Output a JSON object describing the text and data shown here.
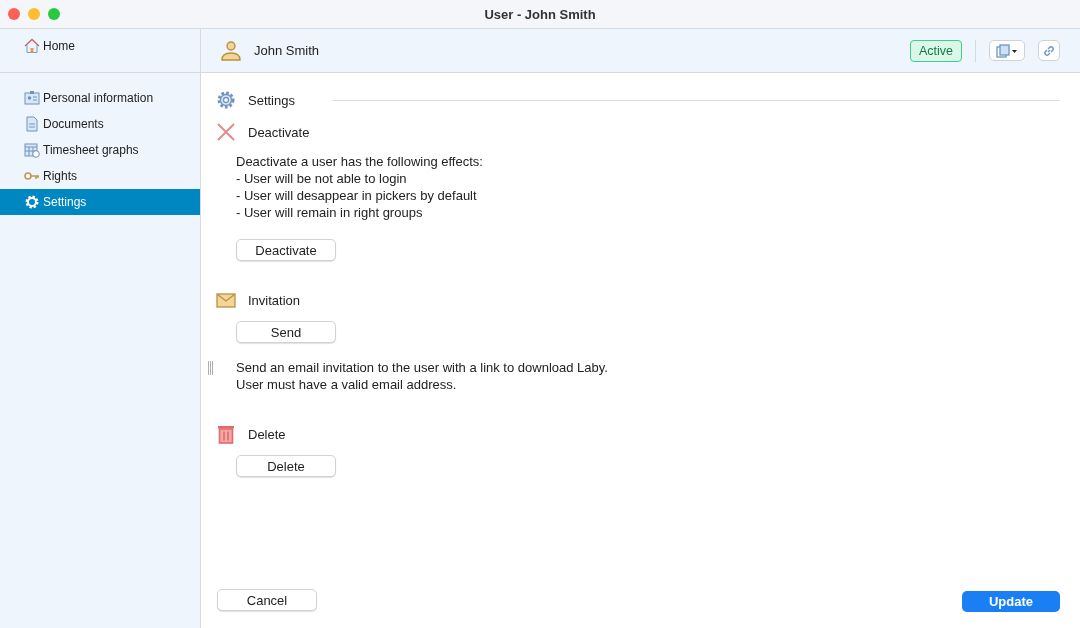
{
  "window": {
    "title": "User - John Smith"
  },
  "sidebar": {
    "home": {
      "label": "Home"
    },
    "items": [
      {
        "label": "Personal information",
        "kind": "person",
        "selected": false
      },
      {
        "label": "Documents",
        "kind": "document",
        "selected": false
      },
      {
        "label": "Timesheet graphs",
        "kind": "graph",
        "selected": false
      },
      {
        "label": "Rights",
        "kind": "rights",
        "selected": false
      },
      {
        "label": "Settings",
        "kind": "settings",
        "selected": true
      }
    ]
  },
  "header": {
    "name": "John Smith",
    "status": "Active"
  },
  "page_title": "Settings",
  "sections": [
    {
      "title": "Deactivate",
      "kind": "deactivate",
      "blocks": [
        {
          "kind": "text",
          "lines": [
            "Deactivate a user has the following effects:",
            "- User will be not able to login",
            "- User will desappear in pickers by default",
            "- User will remain in right groups"
          ]
        },
        {
          "kind": "button",
          "label": "Deactivate"
        }
      ]
    },
    {
      "title": "Invitation",
      "kind": "invitation",
      "blocks": [
        {
          "kind": "button",
          "label": "Send"
        },
        {
          "kind": "text",
          "lines": [
            "Send an email invitation to the user with a link to download Laby.",
            "User must have a valid email address."
          ]
        }
      ]
    },
    {
      "title": "Delete",
      "kind": "delete",
      "blocks": [
        {
          "kind": "button",
          "label": "Delete"
        }
      ]
    }
  ],
  "footer": {
    "cancel": "Cancel",
    "update": "Update"
  }
}
